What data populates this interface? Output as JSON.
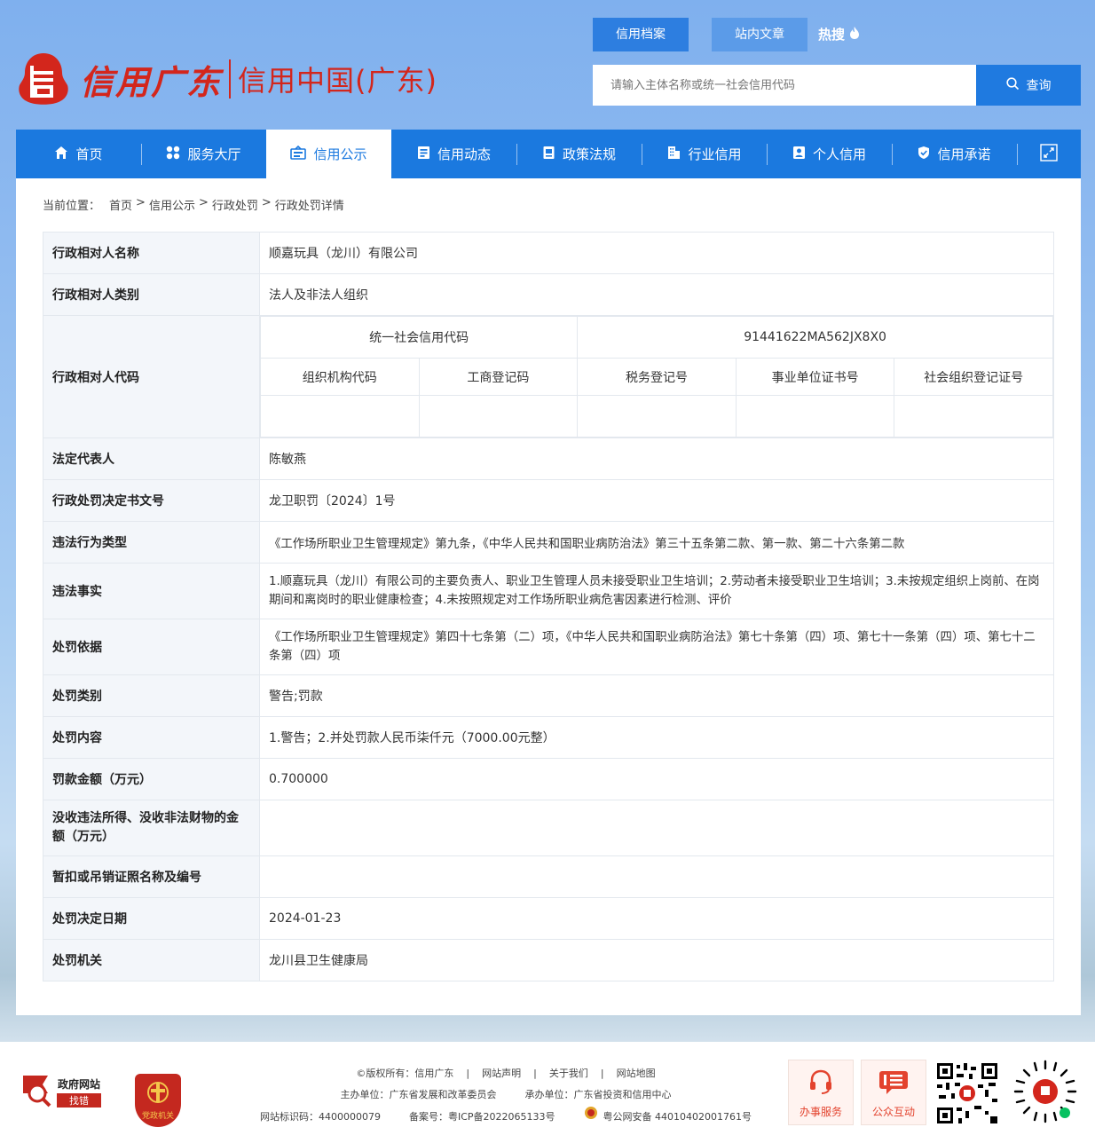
{
  "header": {
    "logo_script": "信用广东",
    "logo_text": "信用中国(广东)",
    "search_tabs": [
      "信用档案",
      "站内文章"
    ],
    "hot_label": "热搜",
    "search_placeholder": "请输入主体名称或统一社会信用代码",
    "search_button": "查询"
  },
  "nav": {
    "items": [
      {
        "label": "首页",
        "icon": "home-icon"
      },
      {
        "label": "服务大厅",
        "icon": "grid-icon"
      },
      {
        "label": "信用公示",
        "icon": "announce-icon"
      },
      {
        "label": "信用动态",
        "icon": "news-icon"
      },
      {
        "label": "政策法规",
        "icon": "book-icon"
      },
      {
        "label": "行业信用",
        "icon": "building-icon"
      },
      {
        "label": "个人信用",
        "icon": "person-icon"
      },
      {
        "label": "信用承诺",
        "icon": "shield-icon"
      }
    ],
    "active_index": 2
  },
  "breadcrumb": {
    "prefix": "当前位置：",
    "items": [
      "首页",
      "信用公示",
      "行政处罚",
      "行政处罚详情"
    ]
  },
  "detail": {
    "name_label": "行政相对人名称",
    "name_value": "顺嘉玩具（龙川）有限公司",
    "type_label": "行政相对人类别",
    "type_value": "法人及非法人组织",
    "code_label": "行政相对人代码",
    "uscc_label": "统一社会信用代码",
    "uscc_value": "91441622MA562JX8X0",
    "code_headers": [
      "组织机构代码",
      "工商登记码",
      "税务登记号",
      "事业单位证书号",
      "社会组织登记证号"
    ],
    "code_values": [
      "",
      "",
      "",
      "",
      ""
    ],
    "legal_rep_label": "法定代表人",
    "legal_rep_value": "陈敏燕",
    "doc_no_label": "行政处罚决定书文号",
    "doc_no_value": "龙卫职罚〔2024〕1号",
    "violation_type_label": "违法行为类型",
    "violation_type_value": "《工作场所职业卫生管理规定》第九条，《中华人民共和国职业病防治法》第三十五条第二款、第一款、第二十六条第二款",
    "facts_label": "违法事实",
    "facts_value": "1.顺嘉玩具（龙川）有限公司的主要负责人、职业卫生管理人员未接受职业卫生培训；2.劳动者未接受职业卫生培训；3.未按规定组织上岗前、在岗期间和离岗时的职业健康检查；4.未按照规定对工作场所职业病危害因素进行检测、评价",
    "basis_label": "处罚依据",
    "basis_value": "《工作场所职业卫生管理规定》第四十七条第（二）项，《中华人民共和国职业病防治法》第七十条第（四）项、第七十一条第（四）项、第七十二条第（四）项",
    "category_label": "处罚类别",
    "category_value": "警告;罚款",
    "content_label": "处罚内容",
    "content_value": "1.警告；2.并处罚款人民币柒仟元（7000.00元整）",
    "amount_label": "罚款金额（万元）",
    "amount_value": "0.700000",
    "confiscation_label": "没收违法所得、没收非法财物的金额（万元）",
    "confiscation_value": "",
    "license_label": "暂扣或吊销证照名称及编号",
    "license_value": "",
    "date_label": "处罚决定日期",
    "date_value": "2024-01-23",
    "authority_label": "处罚机关",
    "authority_value": "龙川县卫生健康局"
  },
  "footer": {
    "gov_error_line1": "政府网站",
    "gov_error_line2": "找错",
    "party_label": "党政机关",
    "copyright": "©版权所有：",
    "links": [
      "信用广东",
      "网站声明",
      "关于我们",
      "网站地图"
    ],
    "sponsor": "主办单位：广东省发展和改革委员会",
    "undertaker": "承办单位：广东省投资和信用中心",
    "site_id": "网站标识码：4400000079",
    "icp": "备案号：粤ICP备2022065133号",
    "police": "粤公网安备 44010402001761号",
    "service_btn": "办事服务",
    "interact_btn": "公众互动"
  },
  "colors": {
    "brand_red": "#d3261c",
    "nav_blue": "#1b79df",
    "label_bg": "#f3f6fa"
  }
}
